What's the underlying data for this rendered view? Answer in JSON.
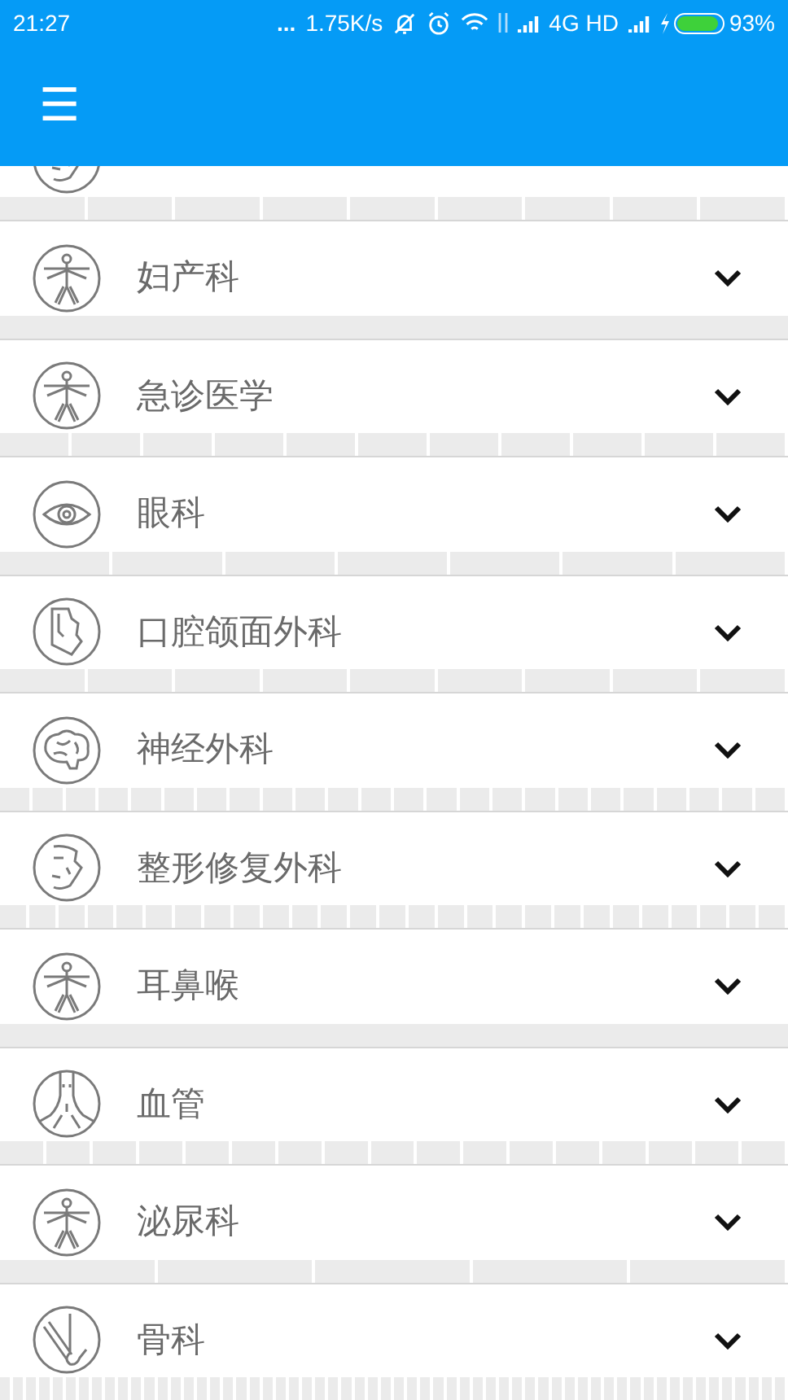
{
  "status_bar": {
    "time": "21:27",
    "dots": "...",
    "speed": "1.75K/s",
    "network": "4G HD",
    "battery": "93%"
  },
  "header": {
    "menu": "☰"
  },
  "departments": [
    {
      "kind": "partial"
    },
    {
      "kind": "full",
      "label": "妇产科"
    },
    {
      "kind": "full",
      "label": "急诊医学"
    },
    {
      "kind": "full",
      "label": "眼科"
    },
    {
      "kind": "full",
      "label": "口腔颌面外科"
    },
    {
      "kind": "full",
      "label": "神经外科"
    },
    {
      "kind": "full",
      "label": "整形修复外科"
    },
    {
      "kind": "full",
      "label": "耳鼻喉"
    },
    {
      "kind": "full",
      "label": "血管"
    },
    {
      "kind": "full",
      "label": "泌尿科"
    },
    {
      "kind": "full",
      "label": "骨科"
    }
  ]
}
